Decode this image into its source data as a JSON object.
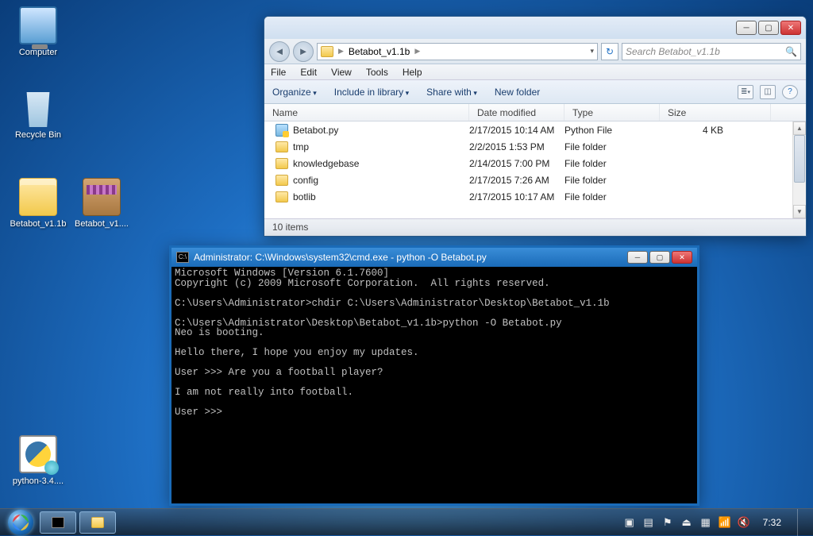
{
  "desktop": {
    "icons": [
      {
        "label": "Computer"
      },
      {
        "label": "Recycle Bin"
      },
      {
        "label": "Betabot_v1.1b"
      },
      {
        "label": "Betabot_v1...."
      },
      {
        "label": "python-3.4...."
      }
    ]
  },
  "explorer": {
    "breadcrumb_root": "Betabot_v1.1b",
    "search_placeholder": "Search Betabot_v1.1b",
    "menu": [
      "File",
      "Edit",
      "View",
      "Tools",
      "Help"
    ],
    "toolbar": {
      "organize": "Organize",
      "include": "Include in library",
      "share": "Share with",
      "newfolder": "New folder"
    },
    "columns": {
      "name": "Name",
      "date": "Date modified",
      "type": "Type",
      "size": "Size"
    },
    "rows": [
      {
        "name": "botlib",
        "date": "2/17/2015 10:17 AM",
        "type": "File folder",
        "size": "",
        "kind": "folder"
      },
      {
        "name": "config",
        "date": "2/17/2015 7:26 AM",
        "type": "File folder",
        "size": "",
        "kind": "folder"
      },
      {
        "name": "knowledgebase",
        "date": "2/14/2015 7:00 PM",
        "type": "File folder",
        "size": "",
        "kind": "folder"
      },
      {
        "name": "tmp",
        "date": "2/2/2015 1:53 PM",
        "type": "File folder",
        "size": "",
        "kind": "folder"
      },
      {
        "name": "Betabot.py",
        "date": "2/17/2015 10:14 AM",
        "type": "Python File",
        "size": "4 KB",
        "kind": "py"
      }
    ],
    "status": "10 items"
  },
  "cmd": {
    "title": "Administrator: C:\\Windows\\system32\\cmd.exe - python  -O Betabot.py",
    "lines": [
      "Microsoft Windows [Version 6.1.7600]",
      "Copyright (c) 2009 Microsoft Corporation.  All rights reserved.",
      "",
      "C:\\Users\\Administrator>chdir C:\\Users\\Administrator\\Desktop\\Betabot_v1.1b",
      "",
      "C:\\Users\\Administrator\\Desktop\\Betabot_v1.1b>python -O Betabot.py",
      "Neo is booting.",
      "",
      "Hello there, I hope you enjoy my updates.",
      "",
      "User >>> Are you a football player?",
      "",
      "I am not really into football.",
      "",
      "User >>> "
    ]
  },
  "taskbar": {
    "clock": "7:32"
  }
}
